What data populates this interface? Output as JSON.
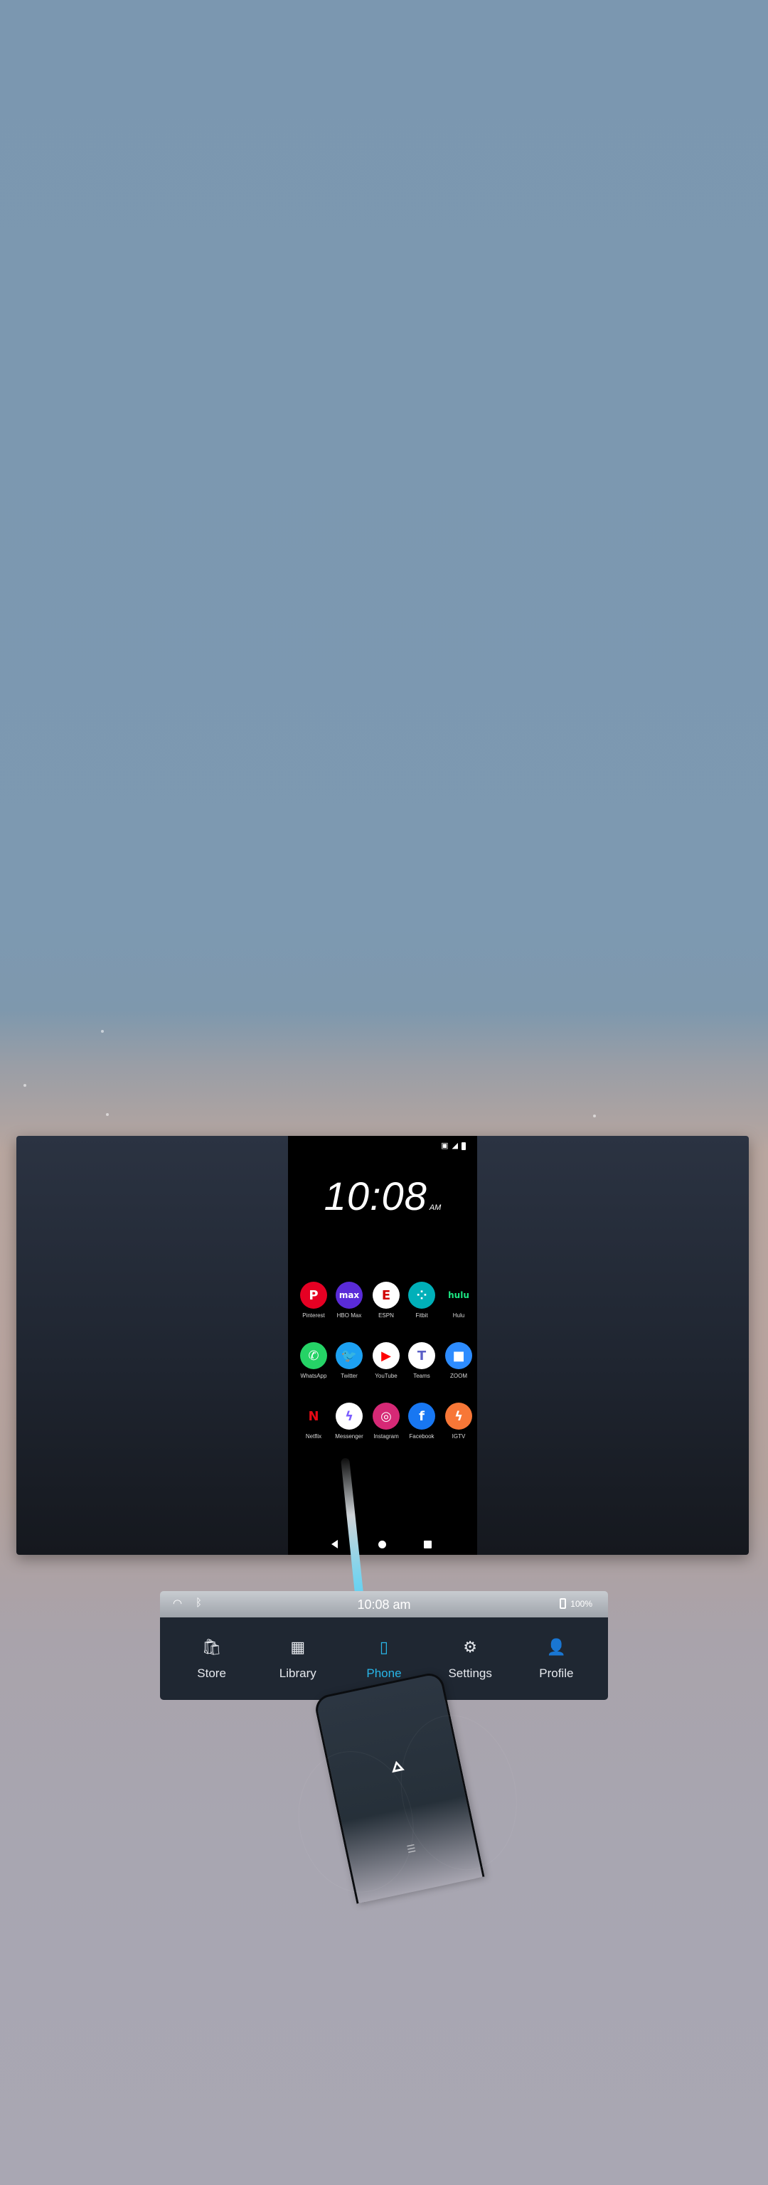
{
  "phone_screen": {
    "status_icons": [
      "nfc-icon",
      "signal-icon",
      "battery-icon"
    ],
    "clock": {
      "time": "10:08",
      "ampm": "AM"
    },
    "apps": [
      {
        "label": "Pinterest",
        "glyph": "P",
        "color": "#e60023",
        "text_color": "#ffffff"
      },
      {
        "label": "HBO Max",
        "glyph": "max",
        "color": "#5a2bd8",
        "text_color": "#ffffff"
      },
      {
        "label": "ESPN",
        "glyph": "E",
        "color": "#ffffff",
        "text_color": "#d00000"
      },
      {
        "label": "Fitbit",
        "glyph": "⁘",
        "color": "#00b0b9",
        "text_color": "#ffffff"
      },
      {
        "label": "Hulu",
        "glyph": "hulu",
        "color": "#000000",
        "text_color": "#1ce783"
      },
      {
        "label": "WhatsApp",
        "glyph": "✆",
        "color": "#25d366",
        "text_color": "#ffffff"
      },
      {
        "label": "Twitter",
        "glyph": "🐦",
        "color": "#1da1f2",
        "text_color": "#ffffff"
      },
      {
        "label": "YouTube",
        "glyph": "▶",
        "color": "#ffffff",
        "text_color": "#ff0000"
      },
      {
        "label": "Teams",
        "glyph": "T",
        "color": "#ffffff",
        "text_color": "#5b5fc7"
      },
      {
        "label": "ZOOM",
        "glyph": "■",
        "color": "#2d8cff",
        "text_color": "#ffffff"
      },
      {
        "label": "Netflix",
        "glyph": "N",
        "color": "#000000",
        "text_color": "#e50914"
      },
      {
        "label": "Messenger",
        "glyph": "ϟ",
        "color": "#ffffff",
        "text_color": "#7b5cff"
      },
      {
        "label": "Instagram",
        "glyph": "◎",
        "color": "#d62976",
        "text_color": "#ffffff"
      },
      {
        "label": "Facebook",
        "glyph": "f",
        "color": "#1877f2",
        "text_color": "#ffffff"
      },
      {
        "label": "IGTV",
        "glyph": "ϟ",
        "color": "#f77737",
        "text_color": "#ffffff"
      }
    ]
  },
  "dock": {
    "status": {
      "wifi_icon": "wifi-icon",
      "bluetooth_icon": "bluetooth-icon",
      "time": "10:08 am",
      "battery": "100%"
    },
    "tabs": [
      {
        "label": "Store",
        "icon": "store-icon",
        "glyph": "🛍",
        "active": false
      },
      {
        "label": "Library",
        "icon": "library-icon",
        "glyph": "▦",
        "active": false
      },
      {
        "label": "Phone",
        "icon": "phone-icon",
        "glyph": "▯",
        "active": true
      },
      {
        "label": "Settings",
        "icon": "settings-icon",
        "glyph": "⚙",
        "active": false
      },
      {
        "label": "Profile",
        "icon": "profile-icon",
        "glyph": "👤",
        "active": false
      }
    ],
    "accent": "#28b6e8"
  },
  "controller": {
    "icon": "home-triangle-icon",
    "menu_icon": "menu-icon"
  }
}
